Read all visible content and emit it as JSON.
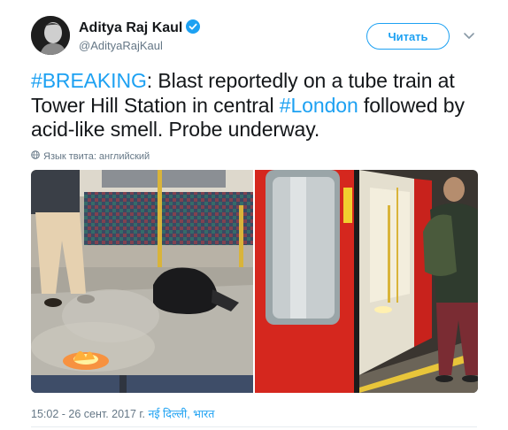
{
  "author": {
    "name": "Aditya Raj Kaul",
    "handle": "@AdityaRajKaul",
    "verified": true,
    "avatar_icon": "profile-avatar"
  },
  "follow_button": {
    "label": "Читать"
  },
  "menu_icon": "chevron-down-icon",
  "tweet": {
    "segments": [
      {
        "text": "#BREAKING",
        "hashtag": true
      },
      {
        "text": ": Blast reportedly on a tube train at Tower Hill Station in central ",
        "hashtag": false
      },
      {
        "text": "#London",
        "hashtag": true
      },
      {
        "text": " followed by acid-like smell. Probe underway.",
        "hashtag": false
      }
    ]
  },
  "language_note": "Язык твита: английский",
  "media": {
    "photos": [
      {
        "description_icon": "train-interior-photo"
      },
      {
        "description_icon": "train-door-platform-photo"
      }
    ]
  },
  "timestamp": {
    "time_date": "15:02 - 26 сент. 2017 г.",
    "location": "नई दिल्ली, भारत"
  },
  "colors": {
    "accent": "#1da1f2",
    "text": "#14171a",
    "secondary": "#657786"
  }
}
